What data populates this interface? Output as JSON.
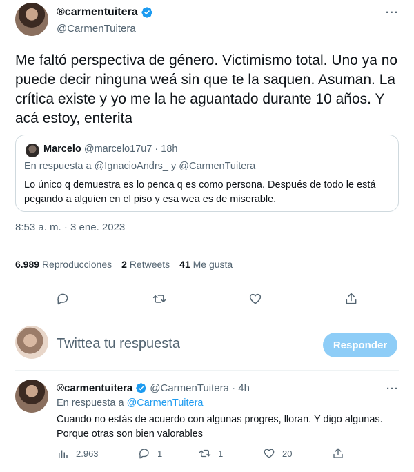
{
  "main_tweet": {
    "display_name": "®carmentuitera",
    "handle": "@CarmenTuitera",
    "text": "Me faltó  perspectiva de género. Victimismo total. Uno ya no puede decir ninguna weá sin que te la saquen. Asuman. La crítica existe y yo me la he aguantado durante 10 años. Y acá estoy, enterita",
    "timestamp": "8:53 a. m. · 3 ene. 2023",
    "more_icon_label": "···"
  },
  "quote": {
    "name": "Marcelo",
    "handle_time": "@marcelo17u7 · 18h",
    "reply_prefix": "En respuesta a ",
    "reply_users": "@IgnacioAndrs_ y @CarmenTuitera",
    "text": "Lo único q demuestra es lo penca q es como persona. Después de todo le está pegando a alguien en el piso y esa wea es de miserable."
  },
  "stats": {
    "views_count": "6.989",
    "views_label": "Reproducciones",
    "retweets_count": "2",
    "retweets_label": "Retweets",
    "likes_count": "41",
    "likes_label": "Me gusta"
  },
  "composer": {
    "placeholder": "Twittea tu respuesta",
    "reply_button": "Responder"
  },
  "reply_tweet": {
    "display_name": "®carmentuitera",
    "handle_time": "@CarmenTuitera · 4h",
    "reply_prefix": "En respuesta a ",
    "reply_user": "@CarmenTuitera",
    "text": "Cuando no estás de acuerdo con algunas progres, lloran. Y digo algunas. Porque otras son bien valorables",
    "more_icon_label": "···",
    "views": "2.963",
    "replies": "1",
    "retweets": "1",
    "likes": "20"
  },
  "colors": {
    "accent": "#1d9bf0",
    "reply_button_disabled": "#8ecdf7",
    "text_primary": "#0f1419",
    "text_secondary": "#536471",
    "divider": "#eff3f4"
  }
}
